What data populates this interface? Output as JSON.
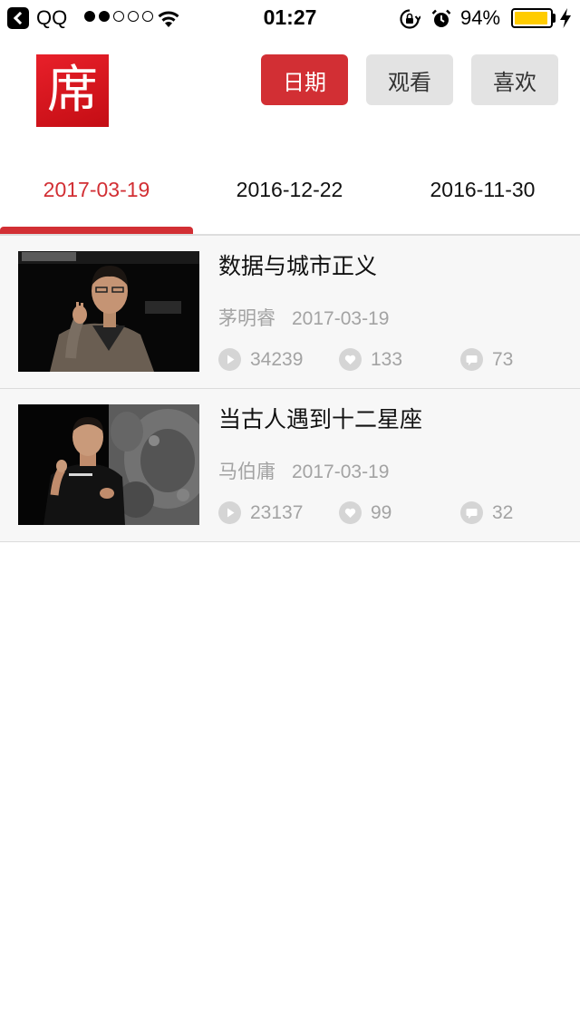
{
  "status_bar": {
    "back_app": "QQ",
    "signal_dots": [
      true,
      true,
      false,
      false,
      false
    ],
    "time": "01:27",
    "battery_percent": "94%",
    "battery_level": 0.94
  },
  "header": {
    "logo_char": "席",
    "buttons": [
      {
        "label": "日期",
        "active": true
      },
      {
        "label": "观看",
        "active": false
      },
      {
        "label": "喜欢",
        "active": false
      }
    ]
  },
  "date_tabs": [
    {
      "label": "2017-03-19",
      "active": true
    },
    {
      "label": "2016-12-22",
      "active": false
    },
    {
      "label": "2016-11-30",
      "active": false
    }
  ],
  "videos": [
    {
      "title": "数据与城市正义",
      "speaker": "茅明睿",
      "date": "2017-03-19",
      "views": "34239",
      "likes": "133",
      "comments": "73"
    },
    {
      "title": "当古人遇到十二星座",
      "speaker": "马伯庸",
      "date": "2017-03-19",
      "views": "23137",
      "likes": "99",
      "comments": "32"
    }
  ],
  "colors": {
    "accent": "#d22f34",
    "battery": "#ffcc00",
    "inactive_button": "#e3e3e3",
    "muted_text": "#a3a3a3"
  },
  "icons": {
    "views": "play-icon",
    "likes": "heart-icon",
    "comments": "comment-icon"
  }
}
